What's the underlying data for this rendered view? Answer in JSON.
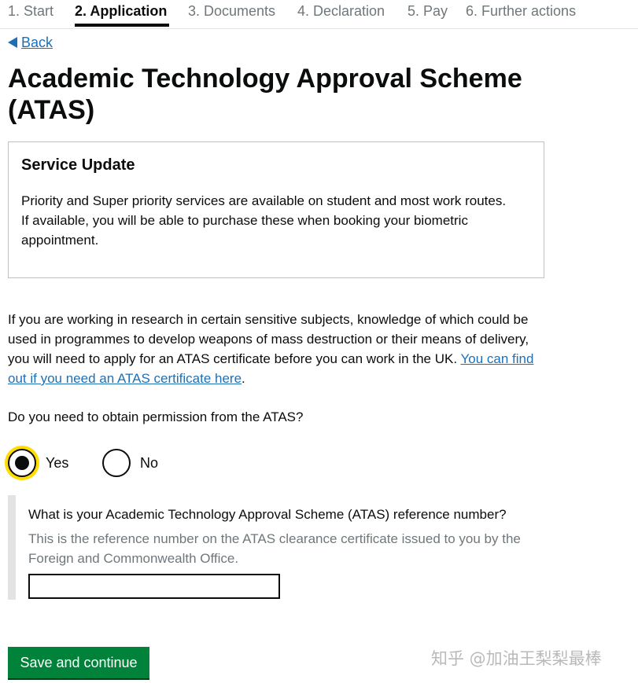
{
  "steps": [
    {
      "label": "1. Start"
    },
    {
      "label": "2. Application",
      "current": true
    },
    {
      "label": "3. Documents"
    },
    {
      "label": "4. Declaration"
    },
    {
      "label": "5. Pay"
    },
    {
      "label": "6. Further actions"
    }
  ],
  "back": {
    "label": "Back"
  },
  "title": "Academic Technology Approval Scheme (ATAS)",
  "notice": {
    "heading": "Service Update",
    "body": "Priority and Super priority services are available on student and most work routes. If available, you will be able to purchase these when booking your biometric appointment."
  },
  "intro": {
    "text": "If you are working in research in certain sensitive subjects, knowledge of which could be used in programmes to develop weapons of mass destruction or their means of delivery, you will need to apply for an ATAS certificate before you can work in the UK. ",
    "link": "You can find out if you need an ATAS certificate here",
    "end": "."
  },
  "question": "Do you need to obtain permission from the ATAS?",
  "options": [
    {
      "label": "Yes",
      "selected": true
    },
    {
      "label": "No",
      "selected": false
    }
  ],
  "reference": {
    "label": "What is your Academic Technology Approval Scheme (ATAS) reference number?",
    "hint": "This is the reference number on the ATAS clearance certificate issued to you by the Foreign and Commonwealth Office.",
    "value": ""
  },
  "save_label": "Save and continue",
  "watermark": "知乎 @加油王梨梨最棒",
  "colors": {
    "link": "#1d70b8",
    "button": "#00823b",
    "focus": "#ffdd00",
    "text": "#0b0c0c",
    "secondary_text": "#6f777b",
    "inset_border": "#e3e3e3"
  }
}
